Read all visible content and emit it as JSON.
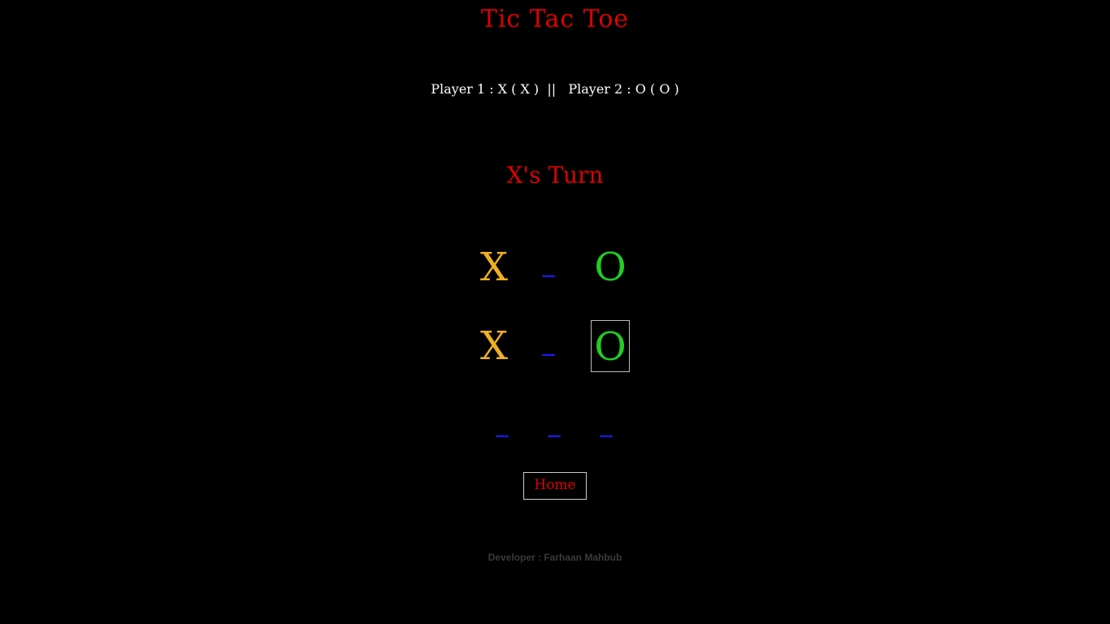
{
  "title": "Tic Tac Toe",
  "players_line": "Player 1 : X ( X )  ||   Player 2 : O ( O )",
  "turn_text": "X's Turn",
  "board": {
    "cells": [
      {
        "mark": "X",
        "state": "x"
      },
      {
        "mark": "_",
        "state": "empty"
      },
      {
        "mark": "O",
        "state": "o"
      },
      {
        "mark": "X",
        "state": "x"
      },
      {
        "mark": "_",
        "state": "empty"
      },
      {
        "mark": "O",
        "state": "o",
        "selected": true
      },
      {
        "mark": "_",
        "state": "empty"
      },
      {
        "mark": "_",
        "state": "empty"
      },
      {
        "mark": "_",
        "state": "empty"
      }
    ]
  },
  "home_button": "Home",
  "developer": "Developer : Farhaan Mahbub",
  "colors": {
    "title": "#e00000",
    "x_mark": "#f0b020",
    "o_mark": "#22cc22",
    "empty_mark": "#1a1aff"
  }
}
